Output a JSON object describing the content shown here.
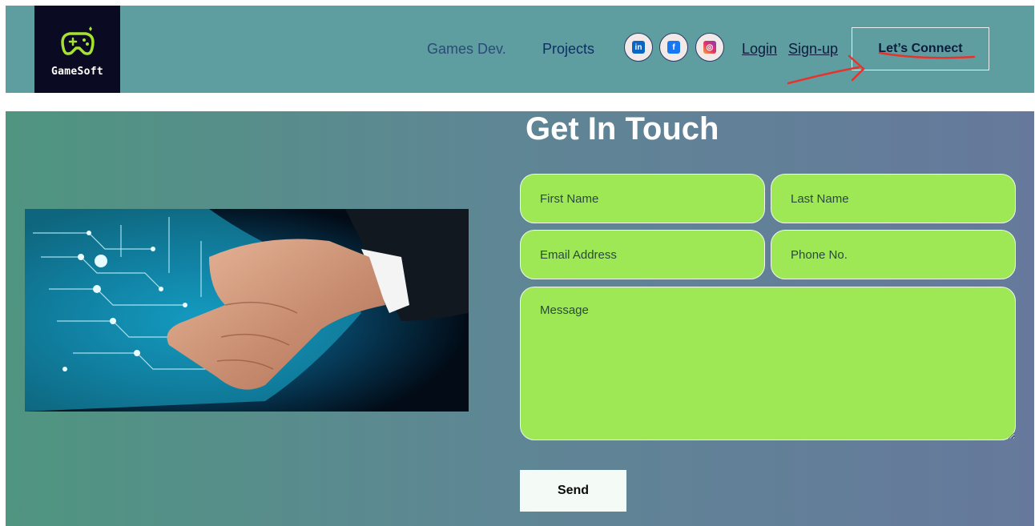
{
  "brand": {
    "logo_text": "GameSoft",
    "logo_bg": "#0a0a23",
    "accent": "#a6e22e"
  },
  "nav": {
    "links": [
      {
        "label": "Games Dev."
      },
      {
        "label": "Projects"
      }
    ],
    "social": [
      {
        "icon": "linkedin-icon",
        "glyph": "in",
        "color": "#0a66c2"
      },
      {
        "icon": "facebook-icon",
        "glyph": "f",
        "color": "#1877f2"
      },
      {
        "icon": "instagram-icon",
        "glyph": "◎",
        "color": "#e1306c"
      }
    ],
    "login": "Login",
    "signup": "Sign-up",
    "connect": "Let’s Connect",
    "bar_color": "#5f9ea0"
  },
  "contact": {
    "title": "Get In Touch",
    "fields": {
      "first_name": "First Name",
      "last_name": "Last Name",
      "email": "Email Address",
      "phone": "Phone No.",
      "message": "Message"
    },
    "send": "Send",
    "field_color": "#9ee855"
  }
}
